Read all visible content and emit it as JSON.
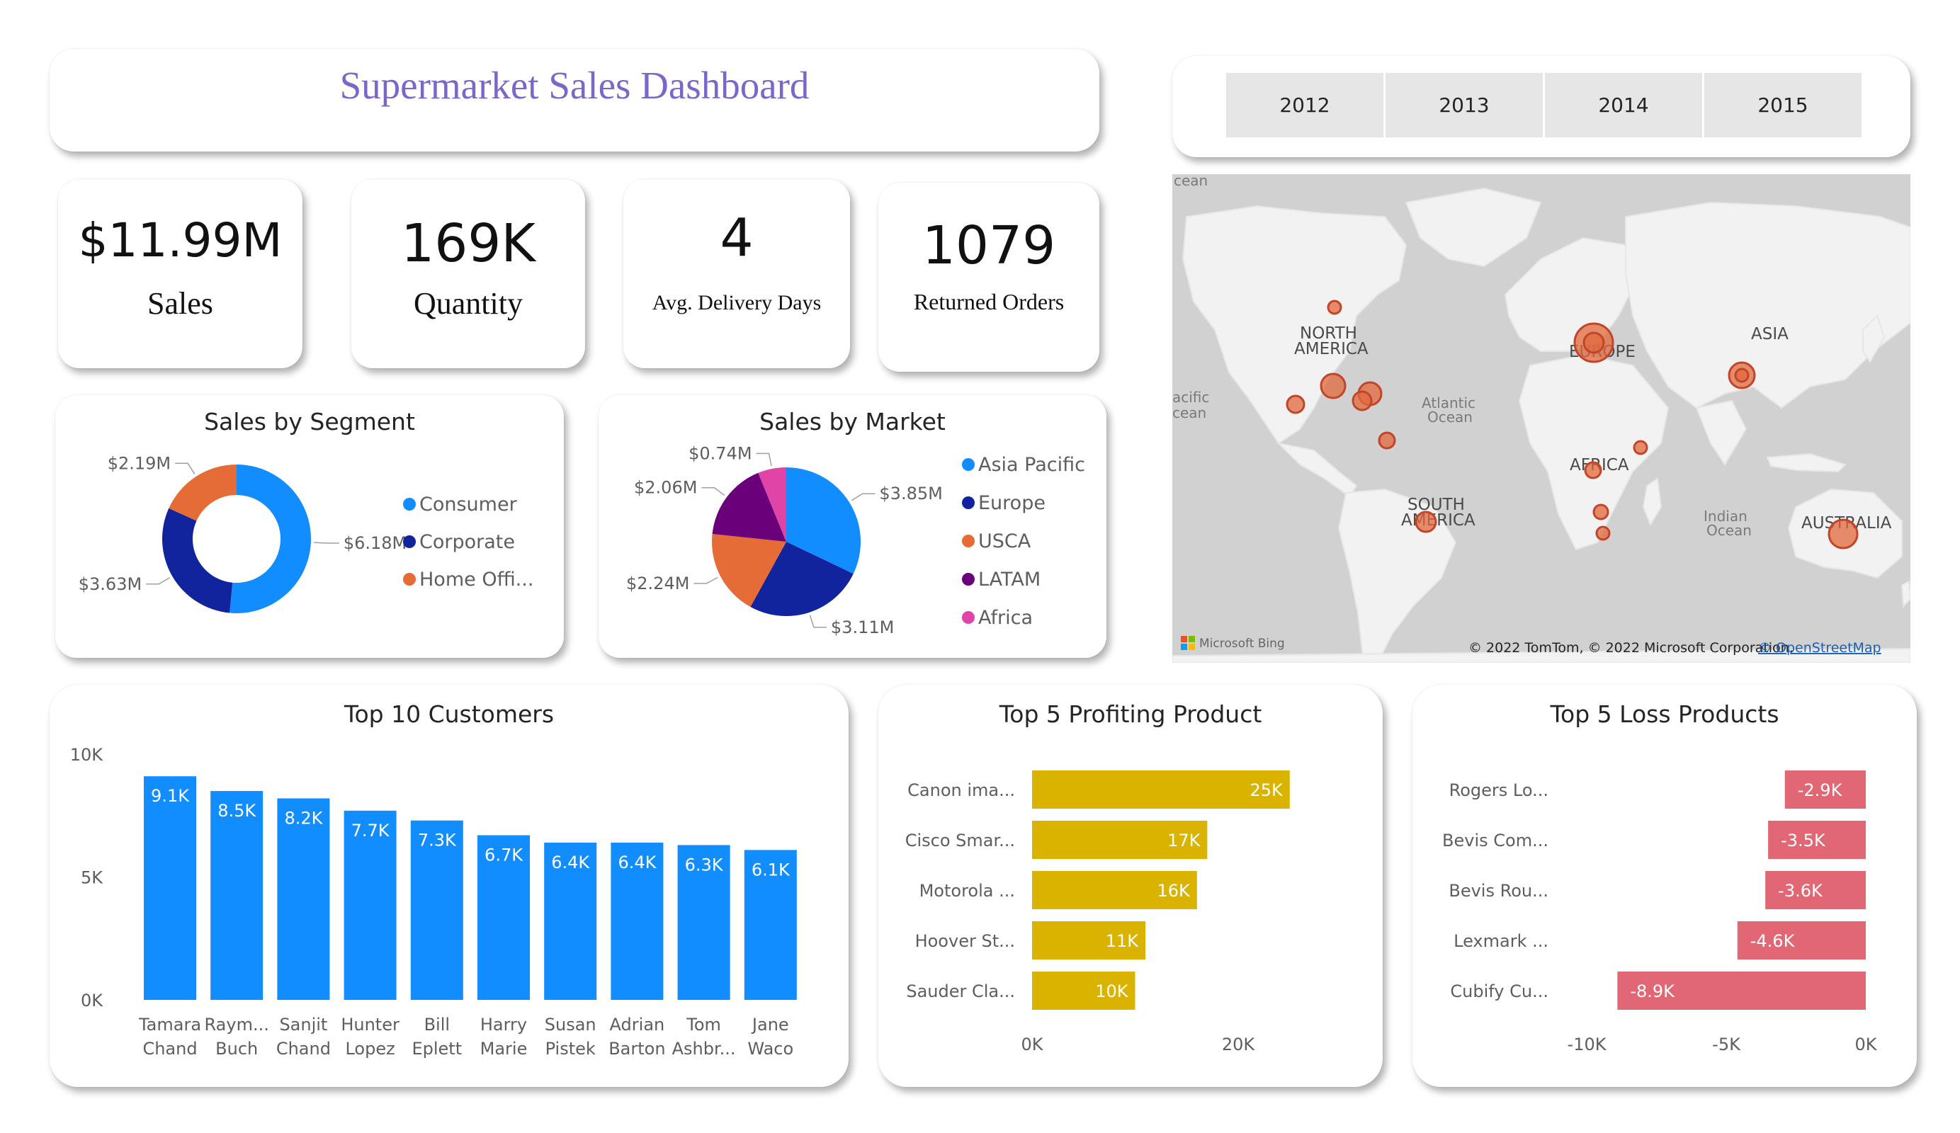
{
  "header": {
    "title": "Supermarket Sales Dashboard"
  },
  "year_slicer": {
    "years": [
      "2012",
      "2013",
      "2014",
      "2015"
    ]
  },
  "kpis": [
    {
      "value": "$11.99M",
      "label": "Sales"
    },
    {
      "value": "169K",
      "label": "Quantity"
    },
    {
      "value": "4",
      "label": "Avg. Delivery Days"
    },
    {
      "value": "1079",
      "label": "Returned Orders"
    }
  ],
  "map": {
    "ocean_labels": [
      "cean",
      "acific",
      "cean",
      "Atlantic",
      "Ocean",
      "Indian",
      "Ocean"
    ],
    "region_labels": [
      "NORTH",
      "AMERICA",
      "EUROPE",
      "ASIA",
      "AFRICA",
      "SOUTH",
      "AMERICA",
      "AUSTRALIA"
    ],
    "bing_logo": "Microsoft Bing",
    "copyright": "© 2022 TomTom, © 2022 Microsoft Corporation,",
    "osm_link": "© OpenStreetMap",
    "bubble_color": "#e0683c"
  },
  "chart_data": [
    {
      "id": "segment",
      "type": "pie",
      "variant": "donut",
      "title": "Sales by Segment",
      "slices": [
        {
          "name": "Consumer",
          "value": 6.18,
          "label": "$6.18M",
          "color": "#118dff"
        },
        {
          "name": "Corporate",
          "value": 3.63,
          "label": "$3.63M",
          "color": "#12239e"
        },
        {
          "name": "Home Offi...",
          "value": 2.19,
          "label": "$2.19M",
          "color": "#e66c37"
        }
      ],
      "legend": "right"
    },
    {
      "id": "market",
      "type": "pie",
      "title": "Sales by Market",
      "slices": [
        {
          "name": "Asia Pacific",
          "value": 3.85,
          "label": "$3.85M",
          "color": "#118dff"
        },
        {
          "name": "Europe",
          "value": 3.11,
          "label": "$3.11M",
          "color": "#12239e"
        },
        {
          "name": "USCA",
          "value": 2.24,
          "label": "$2.24M",
          "color": "#e66c37"
        },
        {
          "name": "LATAM",
          "value": 2.06,
          "label": "$2.06M",
          "color": "#6b007b"
        },
        {
          "name": "Africa",
          "value": 0.74,
          "label": "$0.74M",
          "color": "#e044a7"
        }
      ],
      "legend": "right"
    },
    {
      "id": "customers",
      "type": "bar",
      "title": "Top 10 Customers",
      "categories": [
        [
          "Tamara",
          "Chand"
        ],
        [
          "Raym...",
          "Buch"
        ],
        [
          "Sanjit",
          "Chand"
        ],
        [
          "Hunter",
          "Lopez"
        ],
        [
          "Bill",
          "Eplett"
        ],
        [
          "Harry",
          "Marie"
        ],
        [
          "Susan",
          "Pistek"
        ],
        [
          "Adrian",
          "Barton"
        ],
        [
          "Tom",
          "Ashbr..."
        ],
        [
          "Jane",
          "Waco"
        ]
      ],
      "values": [
        9.1,
        8.5,
        8.2,
        7.7,
        7.3,
        6.7,
        6.4,
        6.4,
        6.3,
        6.1
      ],
      "data_labels": [
        "9.1K",
        "8.5K",
        "8.2K",
        "7.7K",
        "7.3K",
        "6.7K",
        "6.4K",
        "6.4K",
        "6.3K",
        "6.1K"
      ],
      "ylim": [
        0,
        10
      ],
      "yticks": [
        "0K",
        "5K",
        "10K"
      ],
      "color": "#118dff"
    },
    {
      "id": "profit",
      "type": "bar",
      "orientation": "horizontal",
      "title": "Top 5 Profiting Product",
      "categories": [
        "Canon ima...",
        "Cisco Smar...",
        "Motorola ...",
        "Hoover St...",
        "Sauder Cla..."
      ],
      "values": [
        25,
        17,
        16,
        11,
        10
      ],
      "data_labels": [
        "25K",
        "17K",
        "16K",
        "11K",
        "10K"
      ],
      "xlim": [
        0,
        25
      ],
      "xticks": [
        "0K",
        "20K"
      ],
      "color": "#d9b300"
    },
    {
      "id": "loss",
      "type": "bar",
      "orientation": "horizontal",
      "title": "Top 5 Loss Products",
      "categories": [
        "Rogers Lo...",
        "Bevis Com...",
        "Bevis Rou...",
        "Lexmark ...",
        "Cubify Cu..."
      ],
      "values": [
        -2.9,
        -3.5,
        -3.6,
        -4.6,
        -8.9
      ],
      "data_labels": [
        "-2.9K",
        "-3.5K",
        "-3.6K",
        "-4.6K",
        "-8.9K"
      ],
      "xlim": [
        -10,
        0
      ],
      "xticks": [
        "-10K",
        "-5K",
        "0K"
      ],
      "color": "#e06773"
    }
  ]
}
